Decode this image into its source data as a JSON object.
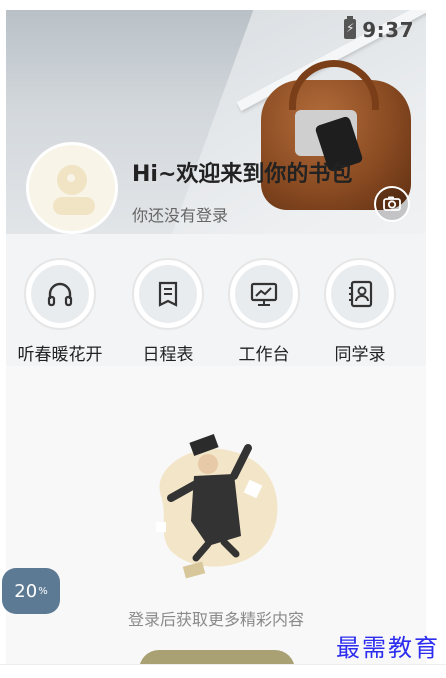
{
  "status_bar": {
    "time": "9:37",
    "battery_icon": "battery-charging-icon"
  },
  "profile": {
    "greeting": "Hi~欢迎来到你的书包",
    "subtitle": "你还没有登录",
    "avatar_icon": "avatar-icon",
    "camera_icon": "camera-icon"
  },
  "menu": {
    "items": [
      {
        "label": "听春暖花开",
        "icon": "headphones-icon"
      },
      {
        "label": "日程表",
        "icon": "schedule-icon"
      },
      {
        "label": "工作台",
        "icon": "workbench-icon"
      },
      {
        "label": "同学录",
        "icon": "contacts-icon"
      }
    ]
  },
  "empty_state": {
    "message": "登录后获取更多精彩内容"
  },
  "float_badge": {
    "value": "20",
    "unit": "%"
  },
  "watermark": "最需教育",
  "colors": {
    "login_button": "#a9a174",
    "badge": "#5c7a94",
    "watermark": "#2d2df0"
  }
}
